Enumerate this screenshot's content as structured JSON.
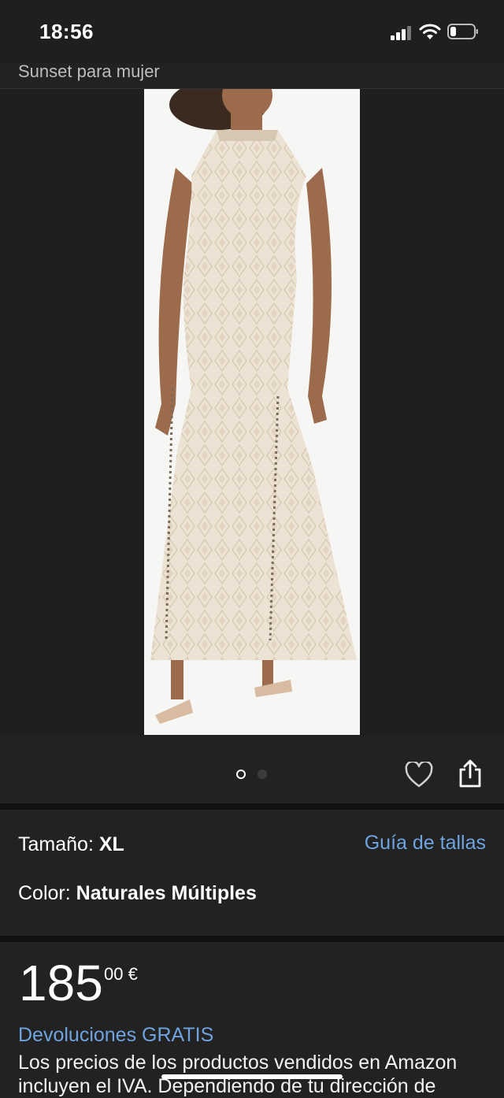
{
  "status_bar": {
    "time": "18:56"
  },
  "header": {
    "brand_link": "Sunset para mujer"
  },
  "carousel": {
    "total_images": 2,
    "active_index": 0
  },
  "options": {
    "size_label": "Tamaño:",
    "size_value": "XL",
    "size_guide": "Guía de tallas",
    "color_label": "Color:",
    "color_value": "Naturales Múltiples"
  },
  "price": {
    "whole": "185",
    "fraction_currency": "00 €",
    "returns": "Devoluciones GRATIS",
    "tax_note": "Los precios de los productos vendidos en Amazon incluyen el IVA. Dependiendo de tu dirección de"
  },
  "colors": {
    "link": "#6ea3e0",
    "background": "#222222"
  }
}
